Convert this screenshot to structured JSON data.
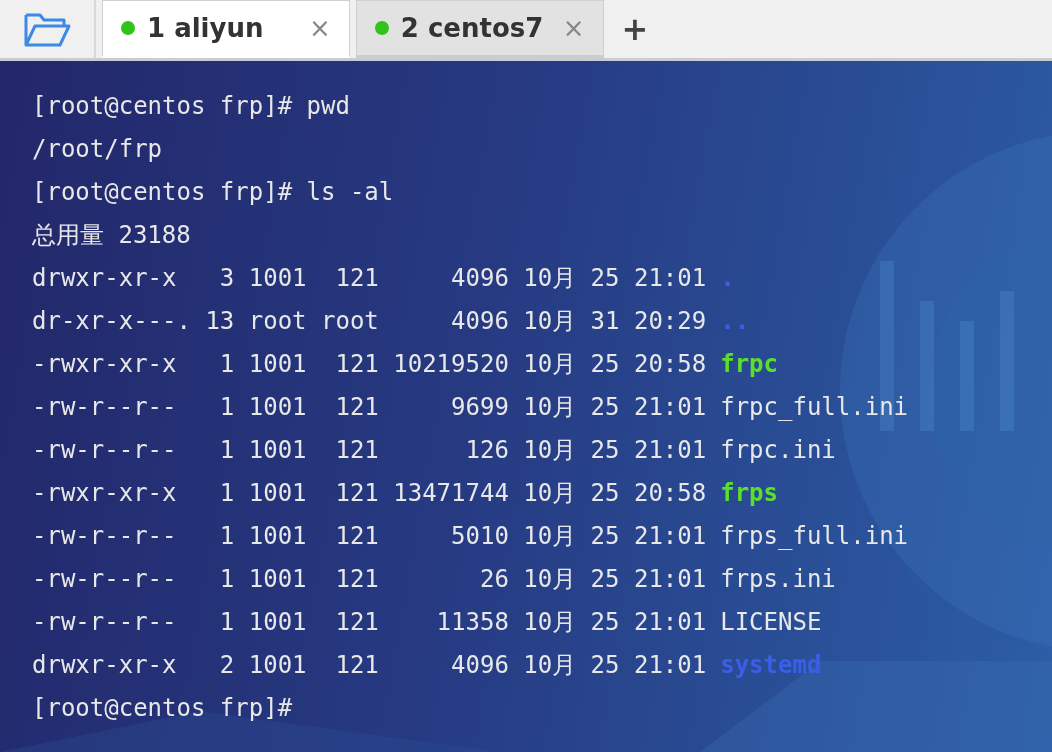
{
  "tabs": [
    {
      "label": "1 aliyun",
      "close": "×",
      "selected": true
    },
    {
      "label": "2 centos7",
      "close": "×",
      "selected": false
    }
  ],
  "new_tab": "+",
  "terminal": {
    "lines": [
      {
        "text": "[root@centos frp]# pwd"
      },
      {
        "text": "/root/frp"
      },
      {
        "text": "[root@centos frp]# ls -al"
      },
      {
        "text": "总用量 23188"
      },
      {
        "text": "drwxr-xr-x   3 1001  121     4096 10月 25 21:01",
        "file": ".",
        "kind": "dir"
      },
      {
        "text": "dr-xr-x---. 13 root root     4096 10月 31 20:29",
        "file": "..",
        "kind": "dir"
      },
      {
        "text": "-rwxr-xr-x   1 1001  121 10219520 10月 25 20:58",
        "file": "frpc",
        "kind": "exec"
      },
      {
        "text": "-rw-r--r--   1 1001  121     9699 10月 25 21:01",
        "file": "frpc_full.ini",
        "kind": "file"
      },
      {
        "text": "-rw-r--r--   1 1001  121      126 10月 25 21:01",
        "file": "frpc.ini",
        "kind": "file"
      },
      {
        "text": "-rwxr-xr-x   1 1001  121 13471744 10月 25 20:58",
        "file": "frps",
        "kind": "exec"
      },
      {
        "text": "-rw-r--r--   1 1001  121     5010 10月 25 21:01",
        "file": "frps_full.ini",
        "kind": "file"
      },
      {
        "text": "-rw-r--r--   1 1001  121       26 10月 25 21:01",
        "file": "frps.ini",
        "kind": "file"
      },
      {
        "text": "-rw-r--r--   1 1001  121    11358 10月 25 21:01",
        "file": "LICENSE",
        "kind": "file"
      },
      {
        "text": "drwxr-xr-x   2 1001  121     4096 10月 25 21:01",
        "file": "systemd",
        "kind": "dir"
      },
      {
        "text": "[root@centos frp]#"
      }
    ]
  }
}
